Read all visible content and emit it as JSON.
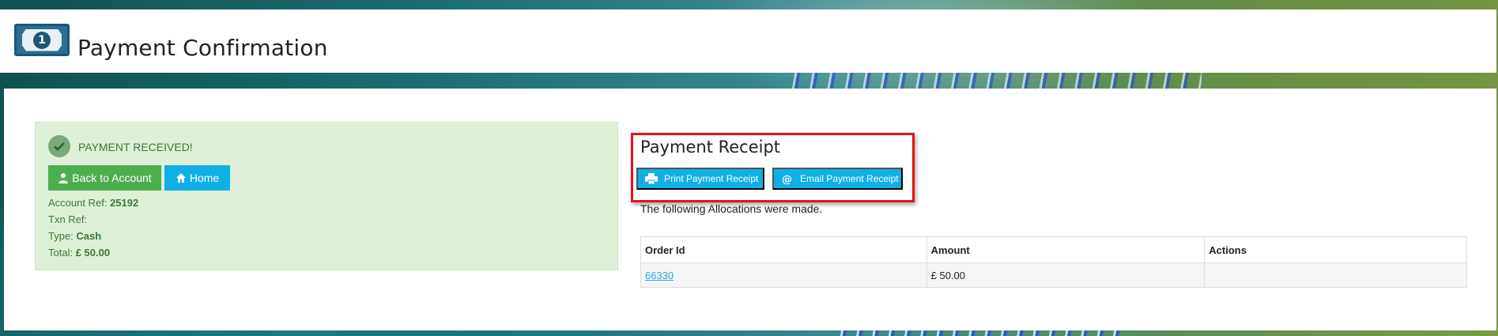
{
  "header": {
    "title": "Payment Confirmation",
    "logo_icon": "banknote-icon",
    "logo_digit": "1"
  },
  "alert": {
    "title": "PAYMENT RECEIVED!",
    "back_button": "Back to Account",
    "home_button": "Home",
    "account_ref_label": "Account Ref:",
    "account_ref_value": "25192",
    "txn_ref_label": "Txn Ref:",
    "txn_ref_value": "",
    "type_label": "Type:",
    "type_value": "Cash",
    "total_label": "Total:",
    "total_value": "£ 50.00"
  },
  "receipt": {
    "title": "Payment Receipt",
    "print_button": "Print Payment Receipt",
    "email_button": "Email Payment Receipt",
    "allocations_text": "The following Allocations were made."
  },
  "table": {
    "headers": [
      "Order Id",
      "Amount",
      "Actions"
    ],
    "rows": [
      {
        "order_id": "66330",
        "amount": "£ 50.00",
        "actions": ""
      }
    ]
  },
  "colors": {
    "success_green": "#4cae4c",
    "info_blue": "#0eb0e6",
    "alert_bg": "#dff0d8",
    "highlight_red": "#e0161a"
  }
}
